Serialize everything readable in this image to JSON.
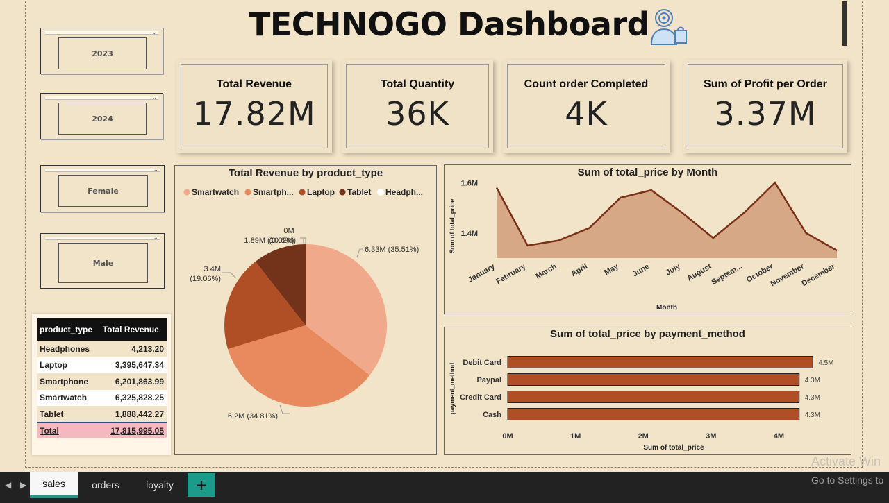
{
  "title": "TECHNOGO Dashboard",
  "slicers": [
    {
      "label": "2023"
    },
    {
      "label": "2024"
    },
    {
      "label": "Female"
    },
    {
      "label": "Male"
    }
  ],
  "kpis": [
    {
      "label": "Total Revenue",
      "value": "17.82M"
    },
    {
      "label": "Total Quantity",
      "value": "36K"
    },
    {
      "label": "Count order Completed",
      "value": "4K"
    },
    {
      "label": "Sum of Profit per Order",
      "value": "3.37M"
    }
  ],
  "table": {
    "headers": [
      "product_type",
      "Total Revenue"
    ],
    "rows": [
      {
        "product_type": "Headphones",
        "revenue": "4,213.20"
      },
      {
        "product_type": "Laptop",
        "revenue": "3,395,647.34"
      },
      {
        "product_type": "Smartphone",
        "revenue": "6,201,863.99"
      },
      {
        "product_type": "Smartwatch",
        "revenue": "6,325,828.25"
      },
      {
        "product_type": "Tablet",
        "revenue": "1,888,442.27"
      }
    ],
    "total": {
      "label": "Total",
      "revenue": "17,815,995.05"
    }
  },
  "colors": {
    "smartwatch": "#f0a98a",
    "smartphone": "#e88a5e",
    "laptop": "#b04e25",
    "tablet": "#73321a",
    "headphones": "#ffffff",
    "line_stroke": "#7a2f17",
    "area_fill": "#d6a886",
    "bar_fill": "#b04e25"
  },
  "chart_data": [
    {
      "type": "pie",
      "title": "Total Revenue by product_type",
      "legend": [
        "Smartwatch",
        "Smartph...",
        "Laptop",
        "Tablet",
        "Headph..."
      ],
      "categories": [
        "Smartwatch",
        "Smartphone",
        "Laptop",
        "Tablet",
        "Headphones"
      ],
      "values": [
        6.33,
        6.2,
        3.4,
        1.89,
        0.0
      ],
      "data_labels": [
        "6.33M (35.51%)",
        "6.2M (34.81%)",
        "3.4M (19.06%)",
        "1.89M (10.6%)",
        "0M (0.02%)"
      ]
    },
    {
      "type": "area",
      "title": "Sum of total_price by Month",
      "xlabel": "Month",
      "ylabel": "Sum of total_price",
      "categories": [
        "January",
        "February",
        "March",
        "April",
        "May",
        "June",
        "July",
        "August",
        "Septem...",
        "October",
        "November",
        "December"
      ],
      "values": [
        1.58,
        1.35,
        1.37,
        1.42,
        1.54,
        1.57,
        1.48,
        1.38,
        1.48,
        1.6,
        1.4,
        1.33
      ],
      "yticks": [
        "1.4M",
        "1.6M"
      ],
      "ytick_values": [
        1.4,
        1.6
      ],
      "ylim": [
        1.3,
        1.62
      ]
    },
    {
      "type": "bar",
      "orientation": "horizontal",
      "title": "Sum of total_price by payment_method",
      "xlabel": "Sum of total_price",
      "ylabel": "payment_method",
      "categories": [
        "Debit Card",
        "Paypal",
        "Credit Card",
        "Cash"
      ],
      "values": [
        4.5,
        4.3,
        4.3,
        4.3
      ],
      "data_labels": [
        "4.5M",
        "4.3M",
        "4.3M",
        "4.3M"
      ],
      "xticks": [
        "0M",
        "1M",
        "2M",
        "3M",
        "4M"
      ],
      "xtick_values": [
        0,
        1,
        2,
        3,
        4
      ],
      "xlim": [
        0,
        4.6
      ]
    }
  ],
  "tabs": [
    {
      "label": "sales",
      "active": true
    },
    {
      "label": "orders",
      "active": false
    },
    {
      "label": "loyalty",
      "active": false
    }
  ],
  "add_tab": "+",
  "nav": {
    "prev": "◀",
    "next": "▶"
  },
  "watermark": {
    "line1": "Activate Win",
    "line2": "Go to Settings to"
  }
}
